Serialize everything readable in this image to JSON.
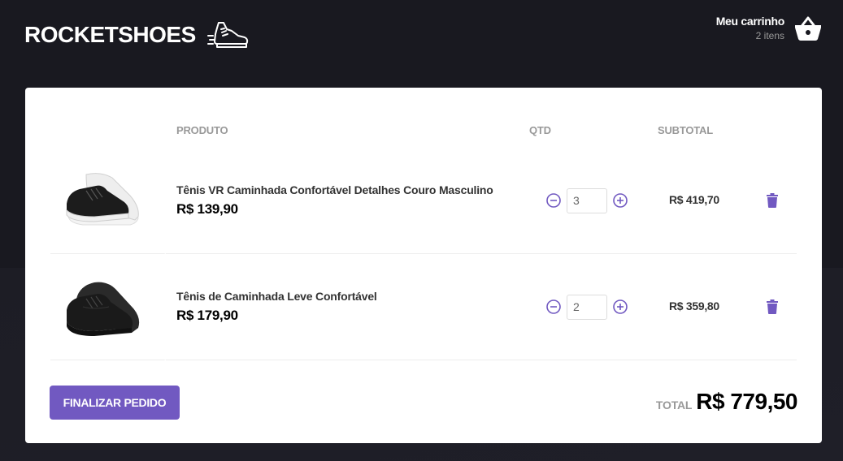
{
  "header": {
    "logo_text": "ROCKETSHOES",
    "logo_icon": "sneaker-icon",
    "cart_title": "Meu carrinho",
    "cart_count": "2 itens",
    "cart_icon": "basket-icon"
  },
  "table": {
    "headers": {
      "product": "PRODUTO",
      "qty": "QTD",
      "subtotal": "SUBTOTAL"
    },
    "items": [
      {
        "title": "Tênis VR Caminhada Confortável Detalhes Couro Masculino",
        "price": "R$ 139,90",
        "qty": "3",
        "subtotal": "R$ 419,70"
      },
      {
        "title": "Tênis de Caminhada Leve Confortável",
        "price": "R$ 179,90",
        "qty": "2",
        "subtotal": "R$ 359,80"
      }
    ]
  },
  "footer": {
    "checkout_label": "FINALIZAR PEDIDO",
    "total_label": "TOTAL",
    "total_value": "R$ 779,50"
  },
  "colors": {
    "background": "#191920",
    "accent": "#7159c1",
    "card": "#ffffff"
  }
}
